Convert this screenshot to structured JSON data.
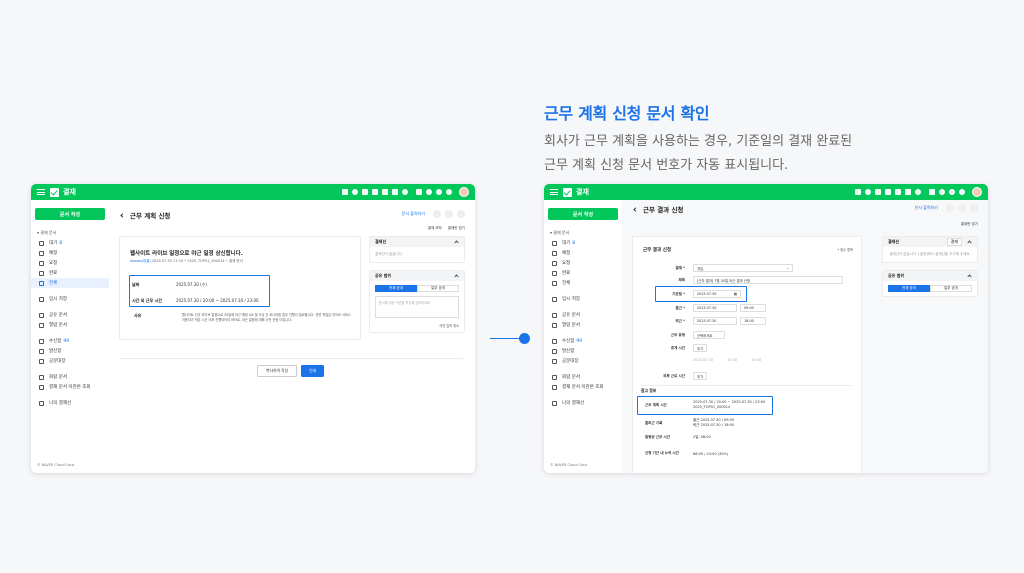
{
  "headline": {
    "title": "근무 계획 신청 문서 확인",
    "line1": "회사가 근무 계획을 사용하는 경우, 기준일의 결재 완료된",
    "line2": "근무 계획 신청 문서 번호가 자동 표시됩니다."
  },
  "app": {
    "title": "결재"
  },
  "sidebar": {
    "compose": "문서 작성",
    "section": "▾ 결재 문서",
    "items": [
      {
        "label": "대기",
        "count": "8"
      },
      {
        "label": "예정",
        "count": ""
      },
      {
        "label": "요청",
        "count": ""
      },
      {
        "label": "완료",
        "count": ""
      },
      {
        "label": "전체",
        "count": ""
      },
      {
        "label": "임시 저장",
        "count": ""
      },
      {
        "label": "공유 문서",
        "count": ""
      },
      {
        "label": "열람 문서",
        "count": ""
      },
      {
        "label": "수신함",
        "count": "99"
      },
      {
        "label": "발신함",
        "count": ""
      },
      {
        "label": "공문대장",
        "count": ""
      },
      {
        "label": "회람 문서",
        "count": ""
      },
      {
        "label": "결재 문서 이관본 조회",
        "count": ""
      },
      {
        "label": "나의 결재선",
        "count": ""
      }
    ],
    "footer": "© NAVER Cloud Corp."
  },
  "left": {
    "page_title": "근무 계획 신청",
    "top_link": "문서 출력하기",
    "subtools": [
      "결재 조작",
      "결재란 접기"
    ],
    "doc": {
      "title": "웹사이트 라이브 일정으로 야근 일정 상신합니다.",
      "writer": "daewa(대결)",
      "meta": "2025.07.30 17:34  •  2025_TOP01_000014  •  결재 문서",
      "date_label": "날짜",
      "date_value": "2025.07.30 (수)",
      "time_label": "시간 외 근무 시간",
      "time_value": "2025.07.30 / 20:00 ~ 2025.07.30 / 23:00",
      "body_label": "사유",
      "body_text": "웹사이트 신규 라이브 일정으로 30일에 야근 예정 QA 및 이상 건 모니터링 업무 진행이 필요합니다. 관련 작업은 라이브 서비스 이용자가 적은 시간 이후 진행되어야 하므로, 야근 일정에 대해 사전 신청 드립니다."
    },
    "panel1": {
      "title": "결재선",
      "placeholder": "결재선이 없습니다"
    },
    "panel2": {
      "title": "공유 범위",
      "tab_on": "전체 공개",
      "tab_off": "일부 공개",
      "placeholder": "문서에 대한 의견을 작성해 입력하세요",
      "foot": "의견 입력  취소"
    },
    "buttons": {
      "secondary": "복사하여 작성",
      "primary": "인쇄"
    }
  },
  "right": {
    "page_title": "근무 결과 신청",
    "top_link": "인사 출력하기",
    "subtools": [
      "결재란 접기"
    ],
    "form_title": "근무 결과 신청",
    "required": "* 필수 항목",
    "rows": [
      {
        "label": "결재 *",
        "value": "개입"
      },
      {
        "label": "제목",
        "value": "[근무 결과] 7월 30일 야근 결과 신청"
      },
      {
        "label": "기준일 *",
        "value": "2025.07.30"
      },
      {
        "label": "출근 *",
        "value": "2025.07.30",
        "value2": "09:00"
      },
      {
        "label": "퇴근 *",
        "value": "2025.07.30",
        "value2": "18:00"
      },
      {
        "label": "근무 유형",
        "value": "선택하세요"
      },
      {
        "label": "휴게 시간",
        "value": "추가"
      },
      {
        "label": "",
        "value": "2025.07.30",
        "value2": "12:00",
        "value3": "13:00"
      },
      {
        "label": "외부 근로 시간",
        "value": "추가"
      }
    ],
    "ref_section": "참고 정보",
    "ref_rows": [
      {
        "label": "근무 계획 시간",
        "value": "2025.07.30 / 20:00 ~ 2025.07.30 / 23:00",
        "link": "2025_TOP01_000014"
      },
      {
        "label": "출퇴근 기록",
        "value": "출근 2025.07.30 / 09:00",
        "value2": "퇴근 2025.07.30 / 18:00"
      },
      {
        "label": "일평균 근무 시간",
        "value": "2일, 08:00"
      },
      {
        "label": "신청 기간 내 누적 시간",
        "value": "88:00 / 24:00 (30%)"
      }
    ],
    "panel1": {
      "title": "결재선",
      "btn": "결재",
      "placeholder": "결재선이 없습니다. [설정]에서 결재선을 추가해 주세요."
    },
    "panel2": {
      "title": "공유 범위",
      "tab_on": "전체 공개",
      "tab_off": "일부 공개"
    }
  }
}
